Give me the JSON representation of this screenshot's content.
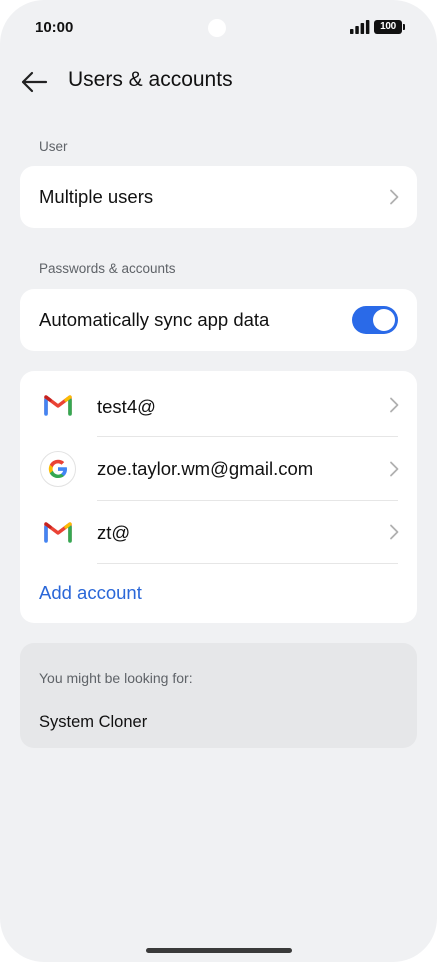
{
  "status_bar": {
    "time": "10:00",
    "battery": "100",
    "signal_icon": "cellular-signal-icon"
  },
  "header": {
    "title": "Users & accounts",
    "back_icon": "back-arrow-icon"
  },
  "sections": {
    "user_label": "User",
    "multiple_users_label": "Multiple users",
    "passwords_label": "Passwords & accounts",
    "auto_sync_label": "Automatically sync app data",
    "auto_sync_on": true
  },
  "accounts": [
    {
      "icon": "gmail-icon",
      "label": "test4@"
    },
    {
      "icon": "google-icon",
      "label": "zoe.taylor.wm@gmail.com"
    },
    {
      "icon": "gmail-icon",
      "label": "zt@"
    }
  ],
  "add_account_label": "Add account",
  "suggestions": {
    "label": "You might be looking for:",
    "items": [
      "System Cloner"
    ]
  },
  "colors": {
    "accent": "#2a6ae8",
    "link": "#2a67d8",
    "background": "#f0f1f3"
  }
}
